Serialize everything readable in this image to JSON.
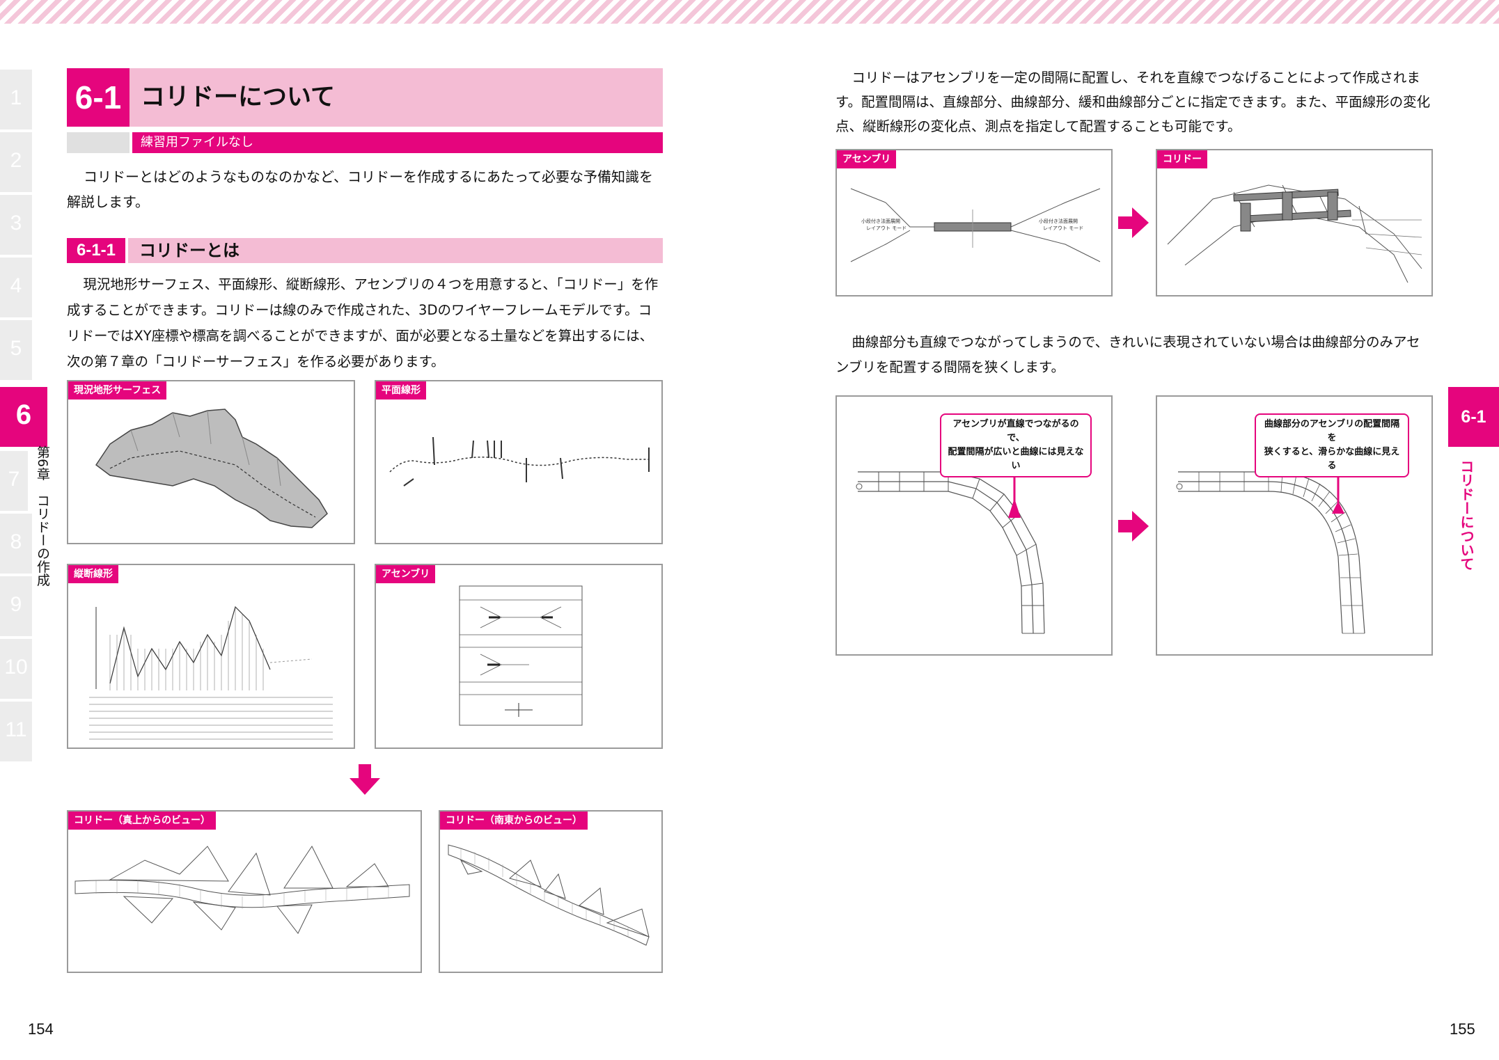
{
  "chapter_tabs": [
    "1",
    "2",
    "3",
    "4",
    "5",
    "6",
    "7",
    "8",
    "9",
    "10",
    "11"
  ],
  "active_tab": "6",
  "chapter_vertical": "第6章　コリドーの作成",
  "section": {
    "number": "6-1",
    "title": "コリドーについて",
    "subbar": "練習用ファイルなし"
  },
  "intro": "コリドーとはどのようなものなのかなど、コリドーを作成するにあたって必要な予備知識を解説します。",
  "subsection": {
    "number": "6-1-1",
    "title": "コリドーとは"
  },
  "body_left": "現況地形サーフェス、平面線形、縦断線形、アセンブリの４つを用意すると、「コリドー」を作成することができます。コリドーは線のみで作成された、3Dのワイヤーフレームモデルです。コリドーではXY座標や標高を調べることができますが、面が必要となる土量などを算出するには、次の第７章の「コリドーサーフェス」を作る必要があります。",
  "figures_left": {
    "surface": "現況地形サーフェス",
    "alignment": "平面線形",
    "profile": "縦断線形",
    "assembly": "アセンブリ",
    "corridor_top": "コリドー（真上からのビュー）",
    "corridor_se": "コリドー（南東からのビュー）"
  },
  "right_para1": "コリドーはアセンブリを一定の間隔に配置し、それを直線でつなげることによって作成されます。配置間隔は、直線部分、曲線部分、緩和曲線部分ごとに指定できます。また、平面線形の変化点、縦断線形の変化点、測点を指定して配置することも可能です。",
  "figures_right": {
    "assembly": "アセンブリ",
    "corridor": "コリドー",
    "asm_left_text": "小段付き法面展開\nレイアウト モード",
    "asm_right_text": "小段付き法面展開\nレイアウト モード"
  },
  "right_para2": "曲線部分も直線でつながってしまうので、きれいに表現されていない場合は曲線部分のみアセンブリを配置する間隔を狭くします。",
  "callouts": {
    "left": "アセンブリが直線でつながるので、\n配置間隔が広いと曲線には見えない",
    "right": "曲線部分のアセンブリの配置間隔を\n狭くすると、滑らかな曲線に見える"
  },
  "page_left": "154",
  "page_right": "155",
  "right_tab": "6-1",
  "right_vertical": "コリドーについて",
  "accent_color": "#e5057d"
}
